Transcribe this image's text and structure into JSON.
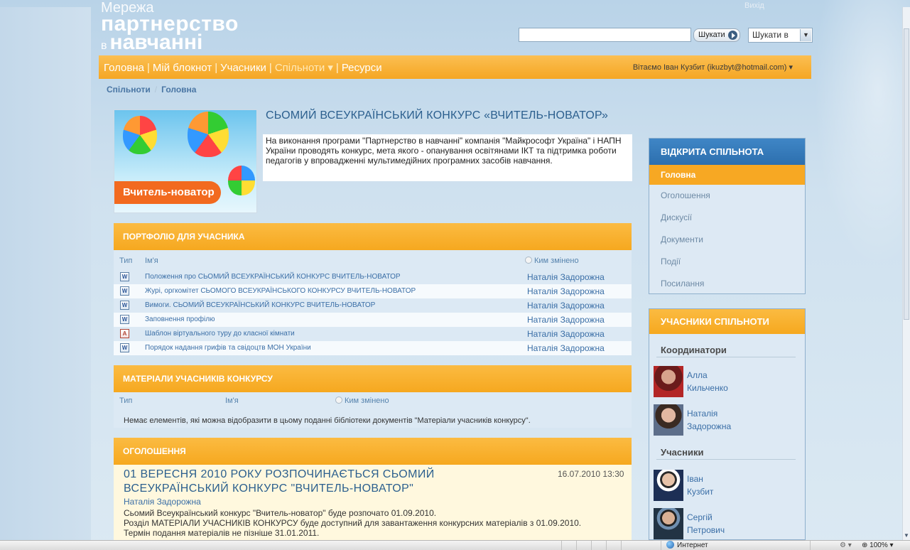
{
  "header": {
    "logo_line1": "Мережа",
    "logo_line2": "партнерство",
    "logo_small": "в",
    "logo_line3": "навчанні",
    "top_link": "Вихід",
    "search_placeholder": "",
    "search_button": "Шукати",
    "search_scope": "Шукати в"
  },
  "nav": {
    "items": [
      {
        "label": "Головна"
      },
      {
        "label": "Мій блокнот"
      },
      {
        "label": "Учасники"
      },
      {
        "label": "Спільноти ▾"
      },
      {
        "label": "Ресурси"
      }
    ],
    "greeting": "Вітаємо Іван Кузбит (ikuzbyt@hotmail.com) ▾"
  },
  "breadcrumb": {
    "root": "Спільноти",
    "sep": "/",
    "current": "Головна"
  },
  "hero": {
    "banner_text": "Вчитель-новатор",
    "title": "СЬОМИЙ ВСЕУКРАЇНСЬКИЙ КОНКУРС «ВЧИТЕЛЬ-НОВАТОР»",
    "intro": "На виконання програми \"Партнерство в навчанні\" компанія \"Майкрософт Україна\" і НАПН України проводять конкурс, мета якого - опанування освітянами ІКТ та підтримка роботи педагогів у впровадженні мультимедійних програмних засобів навчання."
  },
  "portfolio": {
    "heading": "ПОРТФОЛІО ДЛЯ УЧАСНИКА",
    "col_type": "Тип",
    "col_name": "Ім'я",
    "col_modified": "Ким змінено",
    "rows": [
      {
        "icon": "word-doc-icon",
        "name": "Положення про СЬОМИЙ ВСЕУКРАЇНСЬКИЙ КОНКУРС ВЧИТЕЛЬ-НОВАТОР",
        "modified_by": "Наталія Задорожна"
      },
      {
        "icon": "word-doc-icon",
        "name": "Журі, оргкомітет СЬОМОГО ВСЕУКРАЇНСЬКОГО КОНКУРСУ ВЧИТЕЛЬ-НОВАТОР",
        "modified_by": "Наталія Задорожна"
      },
      {
        "icon": "word-doc-icon",
        "name": "Вимоги. СЬОМИЙ ВСЕУКРАЇНСЬКИЙ КОНКУРС ВЧИТЕЛЬ-НОВАТОР",
        "modified_by": "Наталія Задорожна"
      },
      {
        "icon": "word-doc-icon",
        "name": "Заповнення профілю",
        "modified_by": "Наталія Задорожна"
      },
      {
        "icon": "pdf-doc-icon",
        "name": "Шаблон віртуального туру до класної кімнати",
        "modified_by": "Наталія Задорожна"
      },
      {
        "icon": "word-doc-icon",
        "name": "Порядок надання грифів та свідоцтв МОН України",
        "modified_by": "Наталія Задорожна"
      }
    ]
  },
  "materials": {
    "heading": "МАТЕРІАЛИ УЧАСНИКІВ КОНКУРСУ",
    "col_type": "Тип",
    "col_name": "Ім'я",
    "col_modified": "Ким змінено",
    "empty_message": "Немає елементів, які можна відобразити в цьому поданні бібліотеки документів \"Матеріали учасників конкурсу\"."
  },
  "announcements": {
    "heading": "ОГОЛОШЕННЯ",
    "title": "01 ВЕРЕСНЯ 2010 РОКУ РОЗПОЧИНАЄТЬСЯ СЬОМИЙ ВСЕУКРАЇНСЬКИЙ КОНКУРС \"ВЧИТЕЛЬ-НОВАТОР\"",
    "date": "16.07.2010 13:30",
    "author": "Наталія Задорожна",
    "line1": "Сьомий Всеукраїнський конкурс \"Вчитель-новатор\" буде розпочато 01.09.2010.",
    "line2": "Розділ МАТЕРІАЛИ УЧАСНИКІВ КОНКУРСУ буде доступний для завантаження конкурсних матеріалів з 01.09.2010.",
    "line3": "Термін подання матеріалів не пізніше 31.01.2011."
  },
  "community_menu": {
    "heading": "ВІДКРИТА СПІЛЬНОТА",
    "items": [
      {
        "label": "Головна"
      },
      {
        "label": "Оголошення"
      },
      {
        "label": "Дискусії"
      },
      {
        "label": "Документи"
      },
      {
        "label": "Події"
      },
      {
        "label": "Посилання"
      }
    ]
  },
  "members": {
    "heading": "УЧАСНИКИ СПІЛЬНОТИ",
    "coordinators_label": "Координатори",
    "participants_label": "Учасники",
    "coordinators": [
      {
        "first": "Алла",
        "last": "Кильченко"
      },
      {
        "first": "Наталія",
        "last": "Задорожна"
      }
    ],
    "participants": [
      {
        "first": "Іван",
        "last": "Кузбит"
      },
      {
        "first": "Сергій",
        "last": "Петрович"
      }
    ]
  },
  "statusbar": {
    "zone": "Интернет",
    "zoom": "100%"
  }
}
